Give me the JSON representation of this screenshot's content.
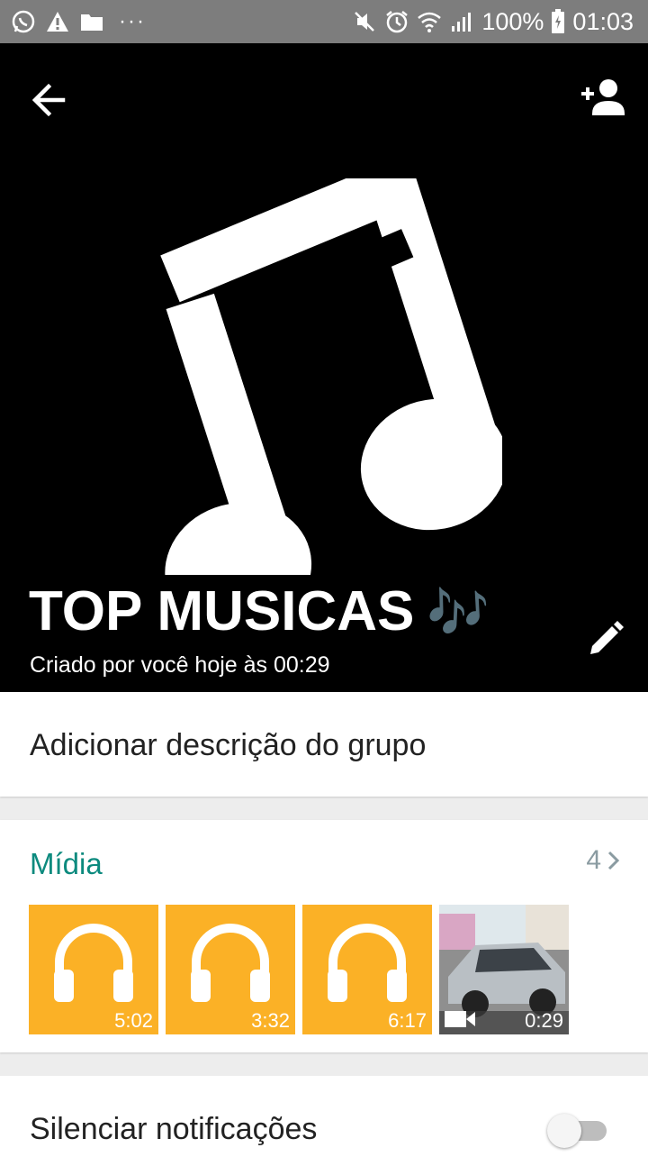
{
  "status_bar": {
    "left_icons": [
      "whatsapp-icon",
      "warning-icon",
      "folder-icon"
    ],
    "more": "···",
    "right_icons": [
      "mute-icon",
      "alarm-icon",
      "wifi-icon",
      "signal-icon",
      "battery-icon"
    ],
    "battery": "100%",
    "time": "01:03"
  },
  "header": {
    "group_name": "TOP MUSICAS",
    "group_emoji": "🎶",
    "created_text": "Criado por você hoje às 00:29",
    "icon": "music-note-icon",
    "back_icon": "arrow-back-icon",
    "add_participant_icon": "add-person-icon",
    "edit_icon": "pencil-icon"
  },
  "description": {
    "label": "Adicionar descrição do grupo"
  },
  "media": {
    "title": "Mídia",
    "count": "4",
    "items": [
      {
        "type": "audio",
        "duration": "5:02"
      },
      {
        "type": "audio",
        "duration": "3:32"
      },
      {
        "type": "audio",
        "duration": "6:17"
      },
      {
        "type": "video",
        "duration": "0:29"
      }
    ],
    "accent": "#0c8a7e",
    "audio_color": "#fbb126"
  },
  "notifications": {
    "mute_label": "Silenciar notificações",
    "mute_enabled": false
  }
}
